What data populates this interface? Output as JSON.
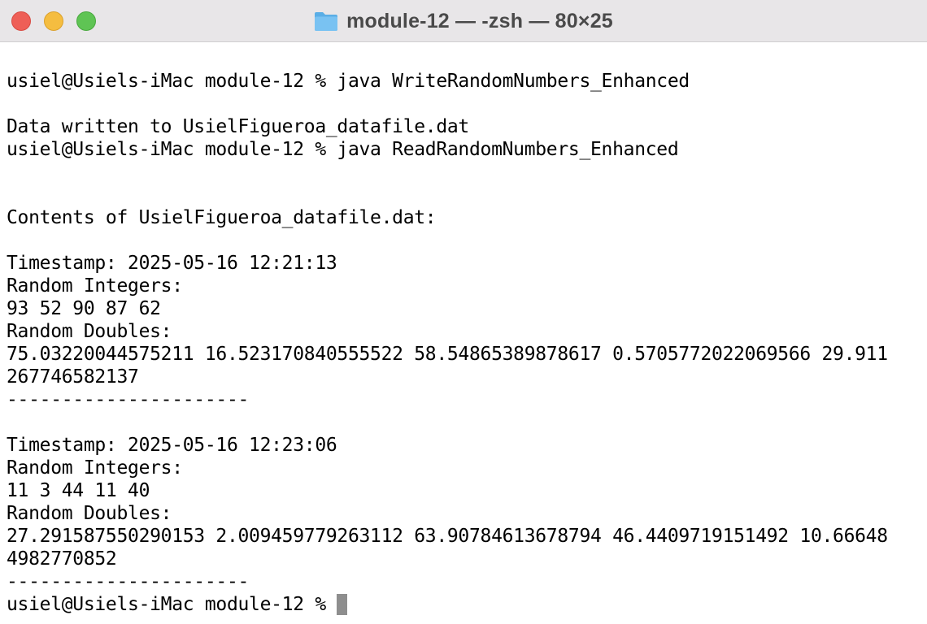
{
  "window": {
    "title": "module-12 — -zsh — 80×25",
    "title_icon": "folder-icon",
    "traffic_lights": {
      "close_color": "#ee5f57",
      "minimize_color": "#f5bd40",
      "zoom_color": "#5fc454"
    }
  },
  "terminal": {
    "lines": [
      "usiel@Usiels-iMac module-12 % java WriteRandomNumbers_Enhanced",
      "",
      "Data written to UsielFigueroa_datafile.dat",
      "usiel@Usiels-iMac module-12 % java ReadRandomNumbers_Enhanced",
      "",
      "",
      "Contents of UsielFigueroa_datafile.dat:",
      "",
      "Timestamp: 2025-05-16 12:21:13",
      "Random Integers:",
      "93 52 90 87 62",
      "Random Doubles:",
      "75.03220044575211 16.523170840555522 58.54865389878617 0.5705772022069566 29.911",
      "267746582137",
      "----------------------",
      "",
      "Timestamp: 2025-05-16 12:23:06",
      "Random Integers:",
      "11 3 44 11 40",
      "Random Doubles:",
      "27.291587550290153 2.009459779263112 63.90784613678794 46.4409719151492 10.66648",
      "4982770852",
      "----------------------"
    ],
    "prompt": "usiel@Usiels-iMac module-12 % ",
    "cursor_color": "#8e8e8e"
  }
}
